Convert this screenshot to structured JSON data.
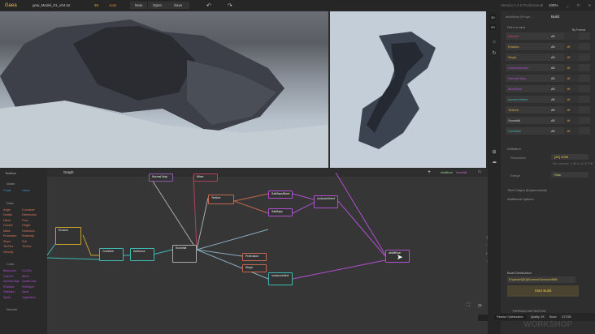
{
  "topbar": {
    "app": "Gaea",
    "file": "gnw_Model_01_v04.tor",
    "resolution": "2K",
    "mode": "Auto",
    "new": "New",
    "open": "Open",
    "save": "Save",
    "version": "Version 1.2.0 Professional",
    "zoom": "100%"
  },
  "right_panel": {
    "tab_properties": "abldiffuse (Prope...",
    "tab_build": "Build",
    "files_section": "Files to save",
    "sort": "By Format",
    "files": [
      {
        "name": "Mesher",
        "color": "#d6407a",
        "all": "All",
        "format": ""
      },
      {
        "name": "Erosion",
        "color": "#e6b23a",
        "all": "All",
        "format": ".tif"
      },
      {
        "name": "Slope",
        "color": "#e6b23a",
        "all": "All",
        "format": ".tif"
      },
      {
        "name": "rockcombined",
        "color": "#b04fd0",
        "all": "All",
        "format": ".tif"
      },
      {
        "name": "Normal Map",
        "color": "#b04fd0",
        "all": "All",
        "format": ".tif"
      },
      {
        "name": "abldiffuse",
        "color": "#b04fd0",
        "all": "All",
        "format": ".tif"
      },
      {
        "name": "snowcombine",
        "color": "#3fb8b0",
        "all": "All",
        "format": ".tif"
      },
      {
        "name": "Texture",
        "color": "#e6b23a",
        "all": "All",
        "format": ".tif"
      },
      {
        "name": "Snowfall",
        "color": "#cfcfcf",
        "all": "All",
        "format": ".tif"
      },
      {
        "name": "Combine",
        "color": "#3fb8b0",
        "all": "All",
        "format": ".tif"
      }
    ],
    "definition": "Definition",
    "resolution_label": "Resolution",
    "resolution_value": "[4K] 4096",
    "memory": "Est. memory : 4.30 to 12.27 GB",
    "range_label": "Range",
    "range_value": "Raw",
    "tiled": "Tiled Output (Experimental)",
    "additional": "Additional Options",
    "dest_label": "Build Destination",
    "dest_value": "D:\\yashar\\[DU]\\Gnomon\\Gnomon\\MW\\",
    "start_build": "Start Build",
    "terrain_def": "TERRAIN DEFINITION"
  },
  "sidebar_icons": [
    "3D",
    "2D"
  ],
  "toolbox": {
    "title": "Toolbox",
    "sections": [
      {
        "name": "Water",
        "items": [
          "Coast",
          "Lakes"
        ],
        "color": "#3a9ad9"
      },
      {
        "name": "Data",
        "items": [
          "Angle",
          "Curvature",
          "Details",
          "Distribution",
          "Dither",
          "Flow",
          "Growth",
          "Height",
          "Mask",
          "Occlusion",
          "Protrusion",
          "Rockmap",
          "Slope",
          "Soil",
          "TexFlex",
          "Texture",
          "Velocity"
        ],
        "color": "#d9785a"
      },
      {
        "name": "Color",
        "items": [
          "Basecolor",
          "CLUTer",
          "ColorFx",
          "Mixer",
          "Normal Map",
          "QuickColor",
          "RGBMix",
          "RGBSplit",
          "SatMaps",
          "Splat",
          "Synth",
          "Vegetation"
        ],
        "color": "#b04fd0"
      },
      {
        "name": "Render",
        "items": []
      }
    ]
  },
  "graph": {
    "tab": "Graph",
    "chip1": "abldiffuse",
    "chip2": "Snowfall",
    "nodes": [
      {
        "label": "Normal Map",
        "color": "#8a5aa8"
      },
      {
        "label": "Mixer",
        "color": "#b0405a"
      },
      {
        "label": "Texture",
        "color": "#c06850"
      },
      {
        "label": "Erosion",
        "color": "#c8a030"
      },
      {
        "label": "Combine",
        "color": "#3fb8b0"
      },
      {
        "label": "Antiscour",
        "color": "#3fb8b0"
      },
      {
        "label": "Snowfall",
        "color": "#aaaaaa"
      },
      {
        "label": "SatMapsBlack",
        "color": "#b04fd0"
      },
      {
        "label": "SatMaps",
        "color": "#b04fd0"
      },
      {
        "label": "rockcombined",
        "color": "#b04fd0"
      },
      {
        "label": "Protrusion",
        "color": "#c06850"
      },
      {
        "label": "Slope",
        "color": "#c06850"
      },
      {
        "label": "snowcombine",
        "color": "#3fb8b0"
      },
      {
        "label": "abldiffuse",
        "color": "#b04fd0"
      }
    ]
  },
  "statusbar": {
    "optimization": "Passive Optimization",
    "quality": "Quality: 2K",
    "snow": "Snow",
    "memory": "3.27GB"
  },
  "watermark": "GNOMON WORKSHOP"
}
